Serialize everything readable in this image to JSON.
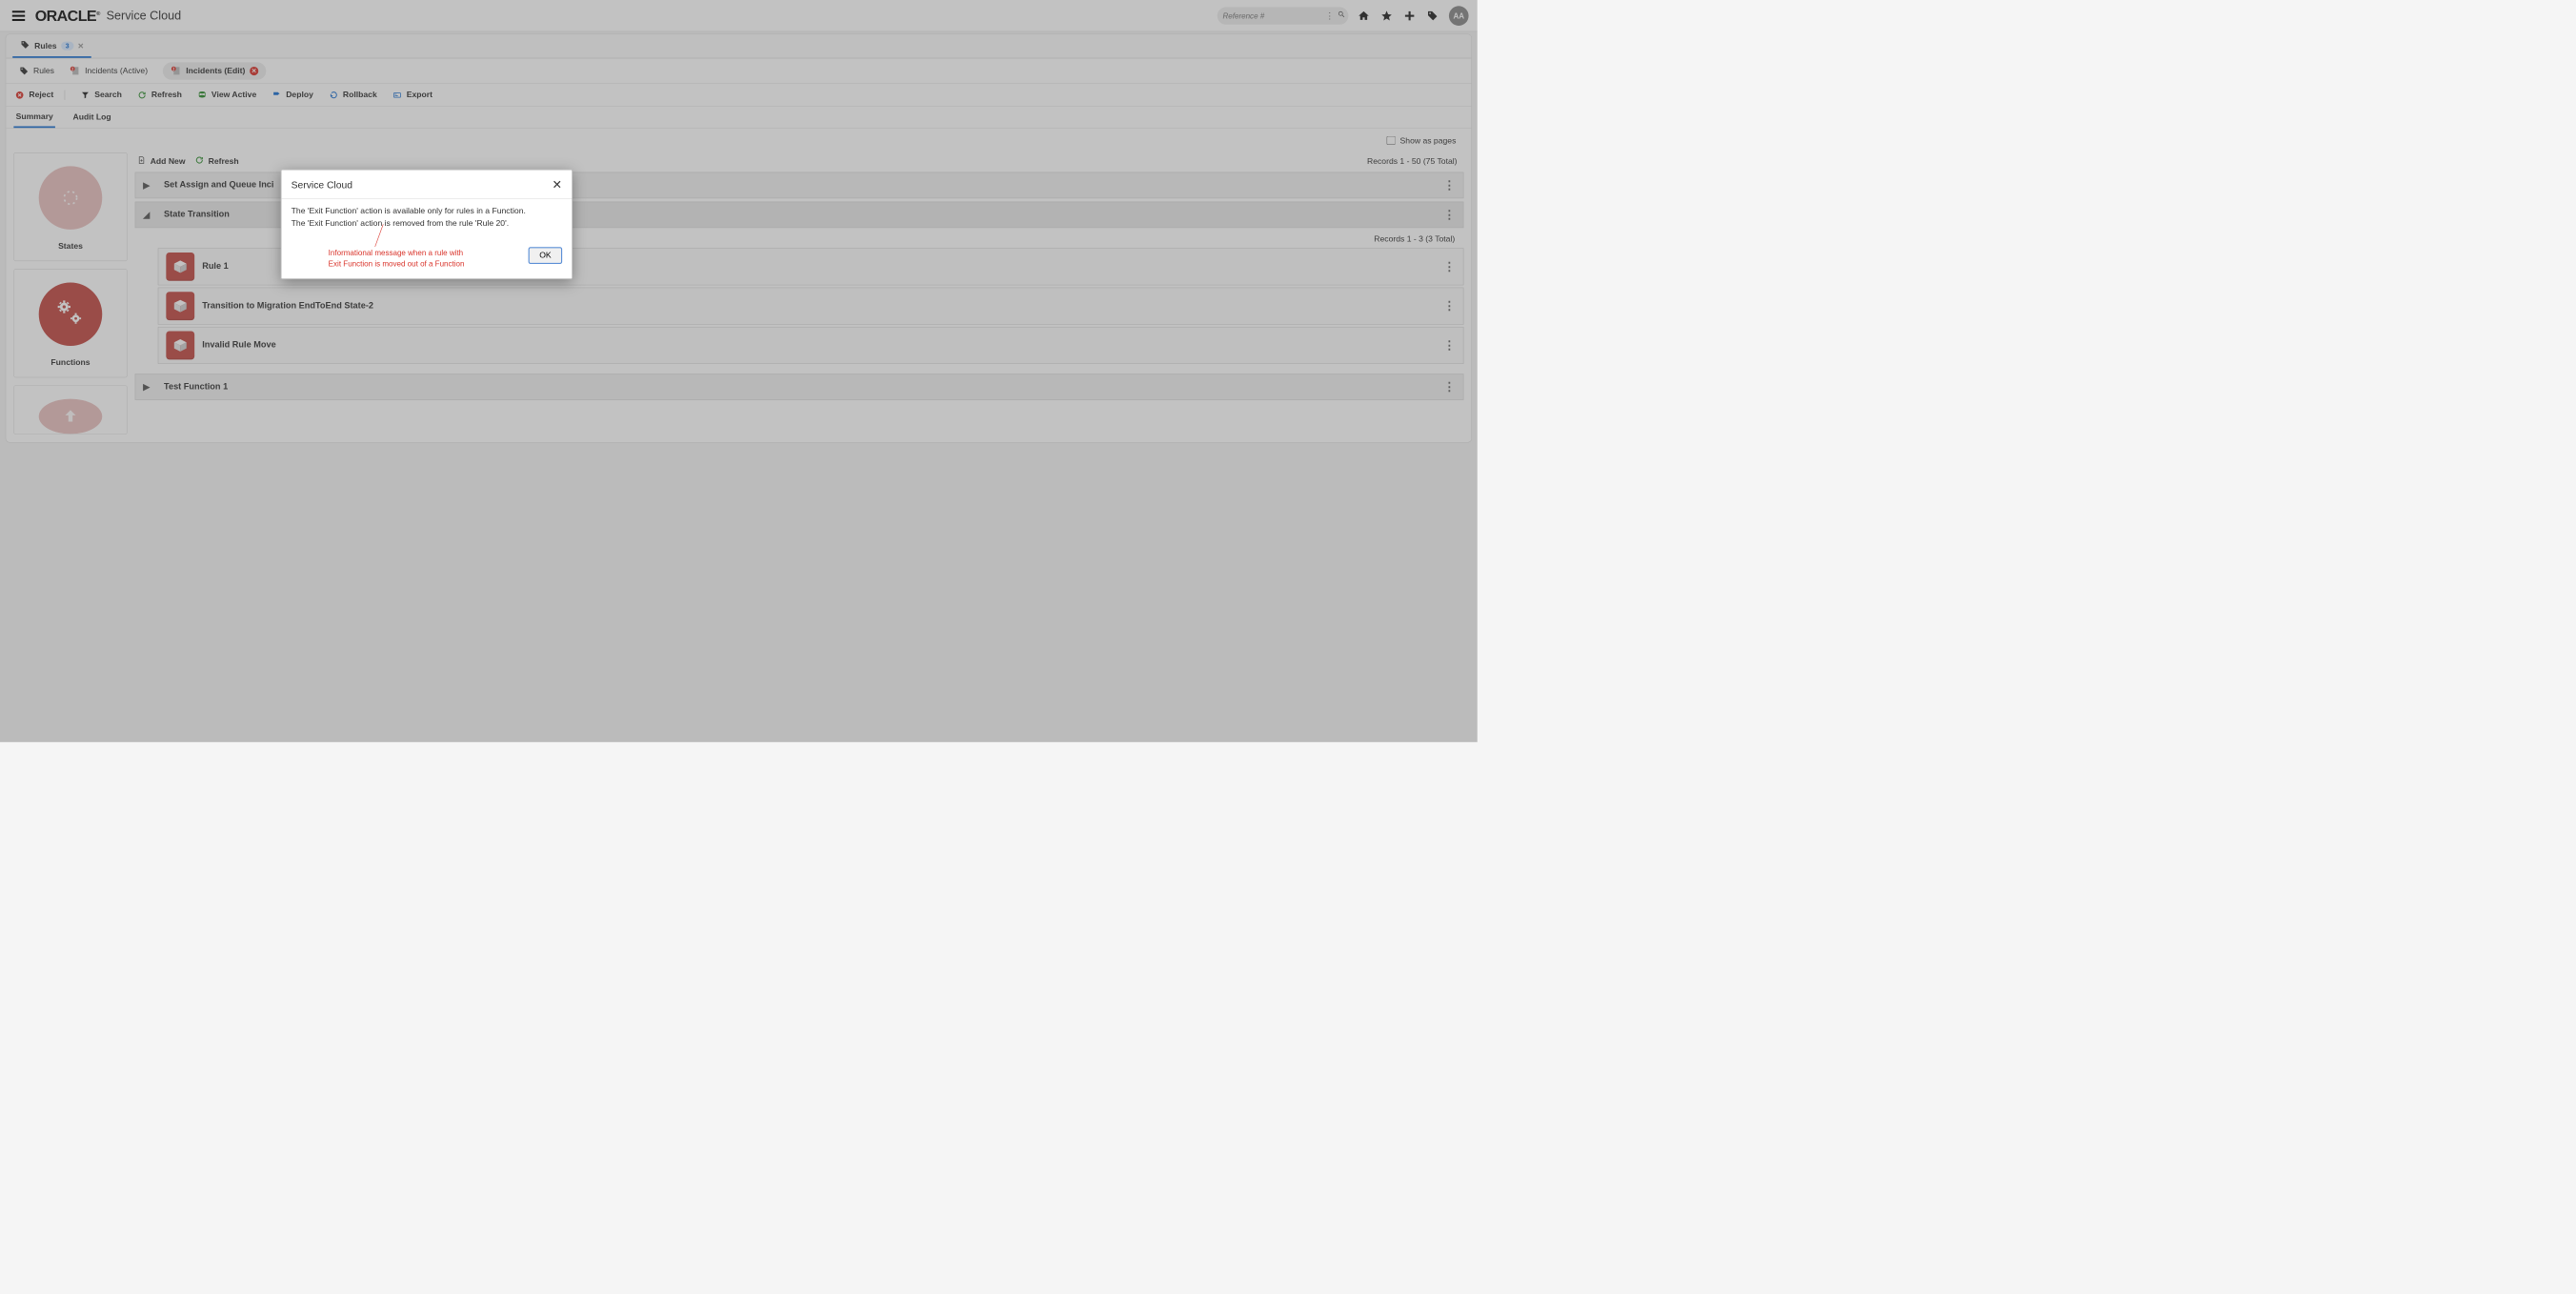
{
  "header": {
    "logo_text": "ORACLE",
    "logo_reg": "®",
    "app_title": "Service Cloud",
    "search_placeholder": "Reference #",
    "avatar_initials": "AA"
  },
  "page_tab": {
    "label": "Rules",
    "badge": "3"
  },
  "sub_tabs": [
    {
      "label": "Rules",
      "type": "tag"
    },
    {
      "label": "Incidents (Active)",
      "type": "file-badge"
    },
    {
      "label": "Incidents (Edit)",
      "type": "file-badge-active",
      "closable": true
    }
  ],
  "actions": {
    "reject": "Reject",
    "search": "Search",
    "refresh": "Refresh",
    "view_active": "View Active",
    "deploy": "Deploy",
    "rollback": "Rollback",
    "export": "Export"
  },
  "section_tabs": {
    "summary": "Summary",
    "audit_log": "Audit Log"
  },
  "options": {
    "show_as_pages": "Show as pages"
  },
  "left_cards": {
    "states": "States",
    "functions": "Functions"
  },
  "list_toolbar": {
    "add_new": "Add New",
    "refresh": "Refresh",
    "records_main": "Records 1 - 50 (75 Total)",
    "records_sub": "Records 1 - 3 (3 Total)"
  },
  "groups": [
    {
      "label": "Set Assign and Queue Inci",
      "expanded": false
    },
    {
      "label": "State Transition",
      "expanded": true
    },
    {
      "label": "Test Function 1",
      "expanded": false
    }
  ],
  "rules": [
    {
      "label": "Rule 1"
    },
    {
      "label": "Transition to Migration EndToEnd State-2"
    },
    {
      "label": "Invalid Rule Move"
    }
  ],
  "modal": {
    "title": "Service Cloud",
    "body_line1": "The 'Exit Function' action is available only for rules in a Function.",
    "body_line2": "The 'Exit Function' action is removed from the rule 'Rule 20'.",
    "annotation": "Informational message when a rule with Exit Function is moved out of a Function",
    "ok": "OK"
  }
}
